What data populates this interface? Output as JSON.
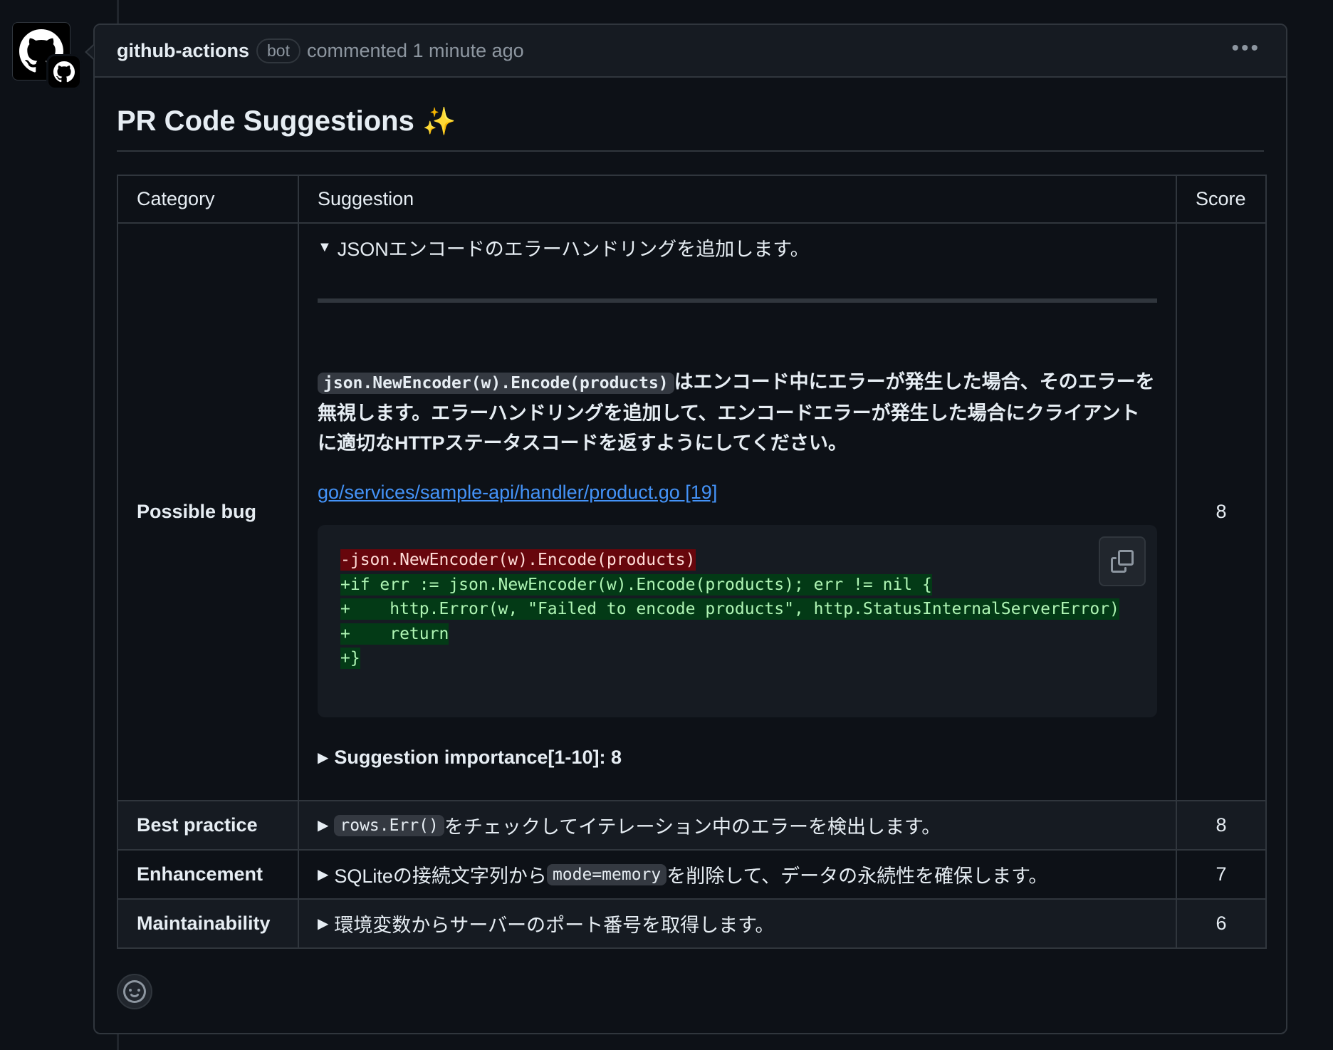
{
  "comment": {
    "author": "github-actions",
    "badge": "bot",
    "meta": "commented 1 minute ago",
    "more_icon": "kebab-horizontal-icon"
  },
  "title": "PR Code Suggestions",
  "title_emoji": "✨",
  "table": {
    "headers": [
      "Category",
      "Suggestion",
      "Score"
    ],
    "rows": [
      {
        "category": "Possible bug",
        "summary": "JSONエンコードのエラーハンドリングを追加します。",
        "desc_code": "json.NewEncoder(w).Encode(products)",
        "desc_text": "はエンコード中にエラーが発生した場合、そのエラーを無視します。エラーハンドリングを追加して、エンコードエラーが発生した場合にクライアントに適切なHTTPステータスコードを返すようにしてください。",
        "file_link": "go/services/sample-api/handler/product.go [19]",
        "diff": [
          {
            "type": "del",
            "text": "-json.NewEncoder(w).Encode(products)"
          },
          {
            "type": "add",
            "text": "+if err := json.NewEncoder(w).Encode(products); err != nil {"
          },
          {
            "type": "add",
            "text": "+    http.Error(w, \"Failed to encode products\", http.StatusInternalServerError)"
          },
          {
            "type": "add",
            "text": "+    return"
          },
          {
            "type": "add",
            "text": "+}"
          }
        ],
        "importance": "Suggestion importance[1-10]: 8",
        "score": "8"
      },
      {
        "category": "Best practice",
        "summary_code": "rows.Err()",
        "summary_after": "をチェックしてイテレーション中のエラーを検出します。",
        "score": "8"
      },
      {
        "category": "Enhancement",
        "summary_before": "SQLiteの接続文字列から",
        "summary_code": "mode=memory",
        "summary_after": "を削除して、データの永続性を確保します。",
        "score": "7"
      },
      {
        "category": "Maintainability",
        "summary": "環境変数からサーバーのポート番号を取得します。",
        "score": "6"
      }
    ]
  },
  "icons": {
    "avatar": "github-octocat-icon",
    "copy": "copy-icon",
    "reaction": "smiley-icon",
    "expanded": "triangle-down-icon",
    "collapsed": "triangle-right-icon"
  },
  "colors": {
    "background": "#0d1117",
    "link": "#4493f8",
    "diff_del_bg": "#67060c",
    "diff_add_bg": "#033a16"
  }
}
